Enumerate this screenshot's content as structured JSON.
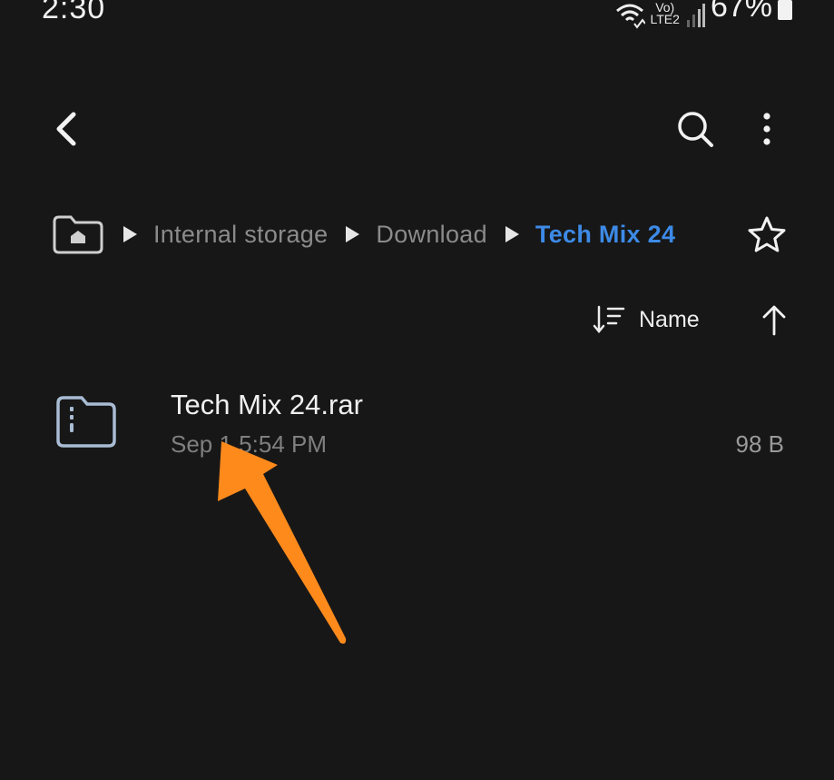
{
  "status_bar": {
    "time": "2:30",
    "network_top": "Vo)",
    "network_bottom": "LTE2",
    "battery": "67%"
  },
  "toolbar": {
    "back_icon": "back-arrow-icon",
    "search_icon": "search-icon",
    "more_icon": "more-vert-icon"
  },
  "breadcrumb": {
    "items": [
      "Internal storage",
      "Download",
      "Tech Mix 24"
    ]
  },
  "sort": {
    "label": "Name",
    "direction": "ascending"
  },
  "files": [
    {
      "name": "Tech Mix 24.rar",
      "date": "Sep 1 5:54 PM",
      "size": "98 B"
    }
  ],
  "annotation": {
    "color": "#ff8a1c"
  },
  "colors": {
    "background": "#171717",
    "accent": "#3d8ae6"
  }
}
